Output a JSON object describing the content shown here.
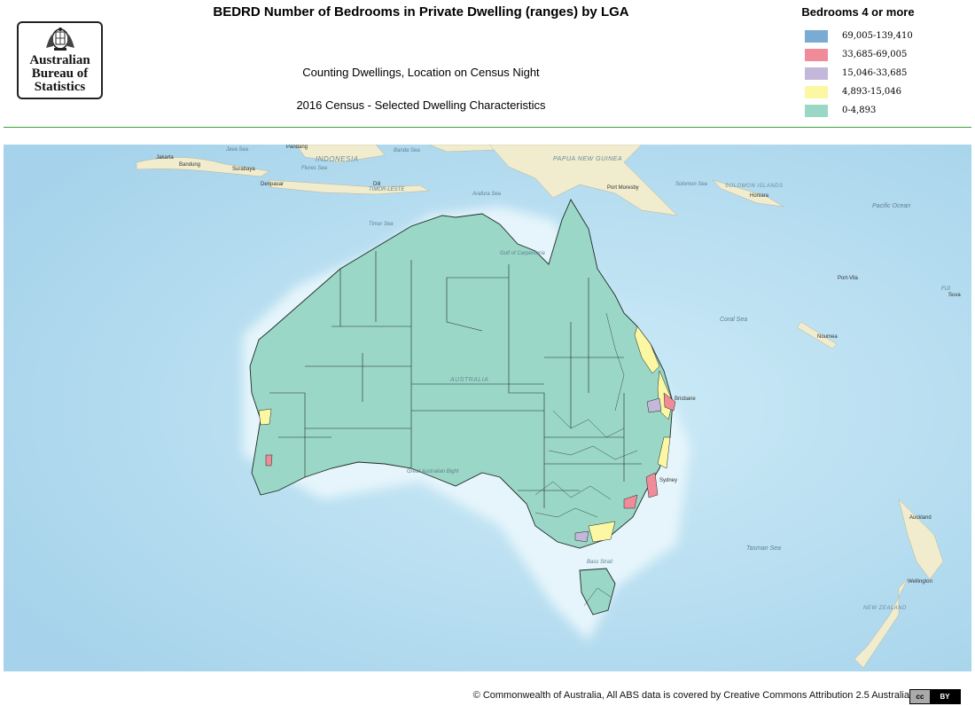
{
  "header": {
    "title": "BEDRD Number of Bedrooms in Private Dwelling (ranges) by LGA",
    "subtitle1": "Counting Dwellings, Location on Census Night",
    "subtitle2": "2016 Census - Selected Dwelling Characteristics"
  },
  "logo": {
    "line1": "Australian",
    "line2": "Bureau of",
    "line3": "Statistics"
  },
  "legend": {
    "title": "Bedrooms 4 or more",
    "items": [
      {
        "label": "69,005-139,410",
        "color": "#7aabd3"
      },
      {
        "label": "33,685-69,005",
        "color": "#f08c99"
      },
      {
        "label": "15,046-33,685",
        "color": "#c3b7da"
      },
      {
        "label": "4,893-15,046",
        "color": "#fbf7a3"
      },
      {
        "label": "0-4,893",
        "color": "#9bd7c6"
      }
    ]
  },
  "map": {
    "colors": {
      "ocean_deep": "#a9d5ec",
      "ocean_shallow": "#d8eff8",
      "land": "#f0eccd",
      "region": "#9bd7c6",
      "boundary": "#1e2a28"
    },
    "labels": {
      "java_sea": "Java Sea",
      "indonesia": "INDONESIA",
      "jakarta": "Jakarta",
      "bandung": "Bandung",
      "surabaya": "Surabaya",
      "denpasar": "Denpasar",
      "dili": "Dili",
      "timor_leste": "TIMOR-LESTE",
      "flores_sea": "Flores Sea",
      "banda_sea": "Banda Sea",
      "arafura_sea": "Arafura Sea",
      "timor_sea": "Timor Sea",
      "gulf_of_carpentaria": "Gulf of Carpentaria",
      "papua_new_guinea": "PAPUA NEW GUINEA",
      "port_moresby": "Port Moresby",
      "solomon_sea": "Solomon Sea",
      "solomon_islands": "SOLOMON ISLANDS",
      "honiara": "Honiara",
      "pacific_ocean": "Pacific Ocean",
      "port_vila": "Port-Vila",
      "fiji": "FIJI",
      "suva": "Suva",
      "coral_sea": "Coral Sea",
      "noumea": "Noumea",
      "australia": "AUSTRALIA",
      "brisbane": "Brisbane",
      "sydney": "Sydney",
      "great_australian_bight": "Great Australian Bight",
      "bass_strait": "Bass Strait",
      "tasman_sea": "Tasman Sea",
      "auckland": "Auckland",
      "wellington": "Wellington",
      "new_zealand": "NEW ZEALAND",
      "pandang": "Pandang"
    }
  },
  "footer": {
    "copyright": "© Commonwealth of Australia,  All ABS data is covered by Creative Commons Attribution 2.5 Australia",
    "cc_badge_left": "cc",
    "cc_badge_right": "BY"
  }
}
